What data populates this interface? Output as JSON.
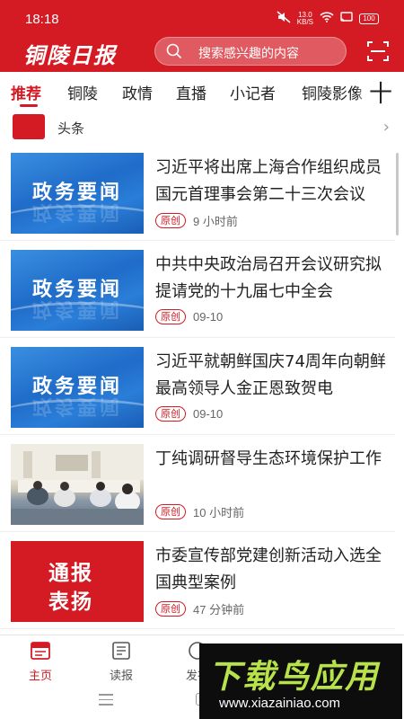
{
  "status_bar": {
    "time": "18:18",
    "net_speed_value": "13.0",
    "net_speed_unit": "KB/S",
    "battery": "100"
  },
  "header": {
    "logo_text": "铜陵日报",
    "search_placeholder": "搜索感兴趣的内容",
    "scan_icon": "scan-icon"
  },
  "tabs": [
    {
      "label": "推荐",
      "active": true
    },
    {
      "label": "铜陵"
    },
    {
      "label": "政情"
    },
    {
      "label": "直播"
    },
    {
      "label": "小记者"
    },
    {
      "label": "铜陵影像"
    }
  ],
  "tab_add_label": "十",
  "headline": {
    "label": "头条",
    "chevron": "›"
  },
  "news": [
    {
      "title": "习近平将出席上海合作组织成员国元首理事会第二十三次会议",
      "badge": "原创",
      "time": "9 小时前",
      "thumb_text": "政务要闻"
    },
    {
      "title": "中共中央政治局召开会议研究拟提请党的十九届七中全会",
      "badge": "原创",
      "time": "09-10",
      "thumb_text": "政务要闻"
    },
    {
      "title": "习近平就朝鲜国庆74周年向朝鲜最高领导人金正恩致贺电",
      "badge": "原创",
      "time": "09-10",
      "thumb_text": "政务要闻"
    },
    {
      "title": "丁纯调研督导生态环境保护工作",
      "badge": "原创",
      "time": "10 小时前"
    },
    {
      "title": "市委宣传部党建创新活动入选全国典型案例",
      "badge": "原创",
      "time": "47 分钟前",
      "thumb_line1": "通报",
      "thumb_line2": "表扬"
    }
  ],
  "bottom_nav": [
    {
      "label": "主页",
      "icon": "news-icon",
      "active": true
    },
    {
      "label": "读报",
      "icon": "newspaper-icon"
    },
    {
      "label": "发布",
      "icon": "publish-icon"
    }
  ],
  "watermark": {
    "title": "下载鸟应用",
    "url": "www.xiazainiao.com"
  },
  "colors": {
    "brand_red": "#d41b24",
    "thumb_blue": "#1f6cc9"
  }
}
